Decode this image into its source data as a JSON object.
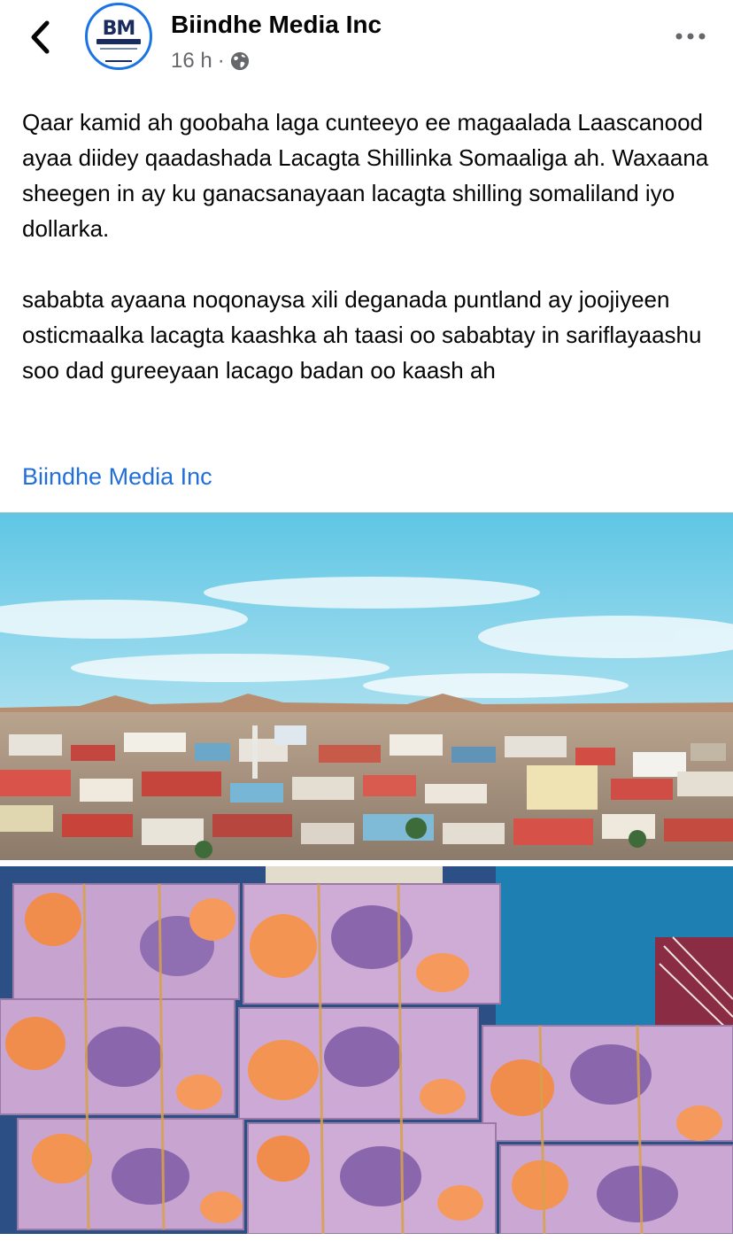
{
  "header": {
    "page_name": "Biindhe Media Inc",
    "avatar_text": "BM",
    "timestamp": "16 h",
    "separator": "·",
    "audience_icon": "globe-icon",
    "back_icon": "chevron-left-icon",
    "more_icon": "more-horizontal-icon"
  },
  "post": {
    "paragraphs": [
      "Qaar kamid ah goobaha laga cunteeyo ee magaalada Laascanood ayaa diidey qaadashada Lacagta Shillinka Somaaliga ah. Waxaana  sheegen in ay ku ganacsanayaan lacagta shilling somaliland iyo dollarka.",
      "sababta ayaana noqonaysa xili deganada puntland ay joojiyeen osticmaalka lacagta kaashka ah taasi oo sababtay in sariflayaashu soo dad gureeyaan lacago badan oo kaash ah"
    ],
    "tagged_page": "Biindhe Media Inc"
  },
  "colors": {
    "link": "#216fdb",
    "secondary_text": "#65676b",
    "avatar_ring": "#1b74e4"
  }
}
